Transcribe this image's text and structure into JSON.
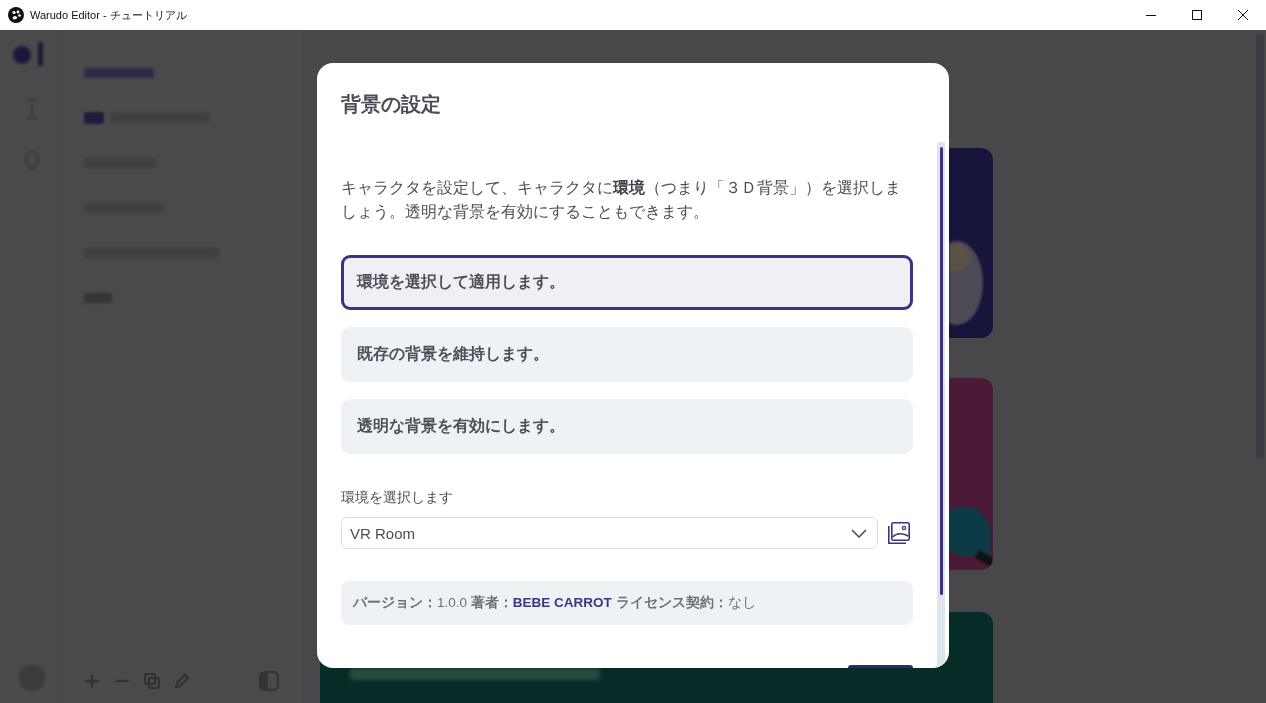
{
  "window": {
    "title": "Warudo Editor - チュートリアル"
  },
  "dialog": {
    "title": "背景の設定",
    "description": "キャラクタを設定して、キャラクタに**環境**（つまり「３Ｄ背景」）を選択しましょう。透明な背景を有効にすることもできます。",
    "options": [
      {
        "label": "環境を選択して適用します。",
        "selected": true
      },
      {
        "label": "既存の背景を維持します。",
        "selected": false
      },
      {
        "label": "透明な背景を有効にします。",
        "selected": false
      }
    ],
    "environment_select": {
      "label": "環境を選択します",
      "value": "VR Room"
    },
    "info": [
      {
        "label": "バージョン：",
        "value": "1.0.0",
        "kind": "plain"
      },
      {
        "label": "著者：",
        "value": "BEBE CARROT",
        "kind": "highlight"
      },
      {
        "label": "ライセンス契約：",
        "value": "なし",
        "kind": "plain"
      }
    ]
  }
}
